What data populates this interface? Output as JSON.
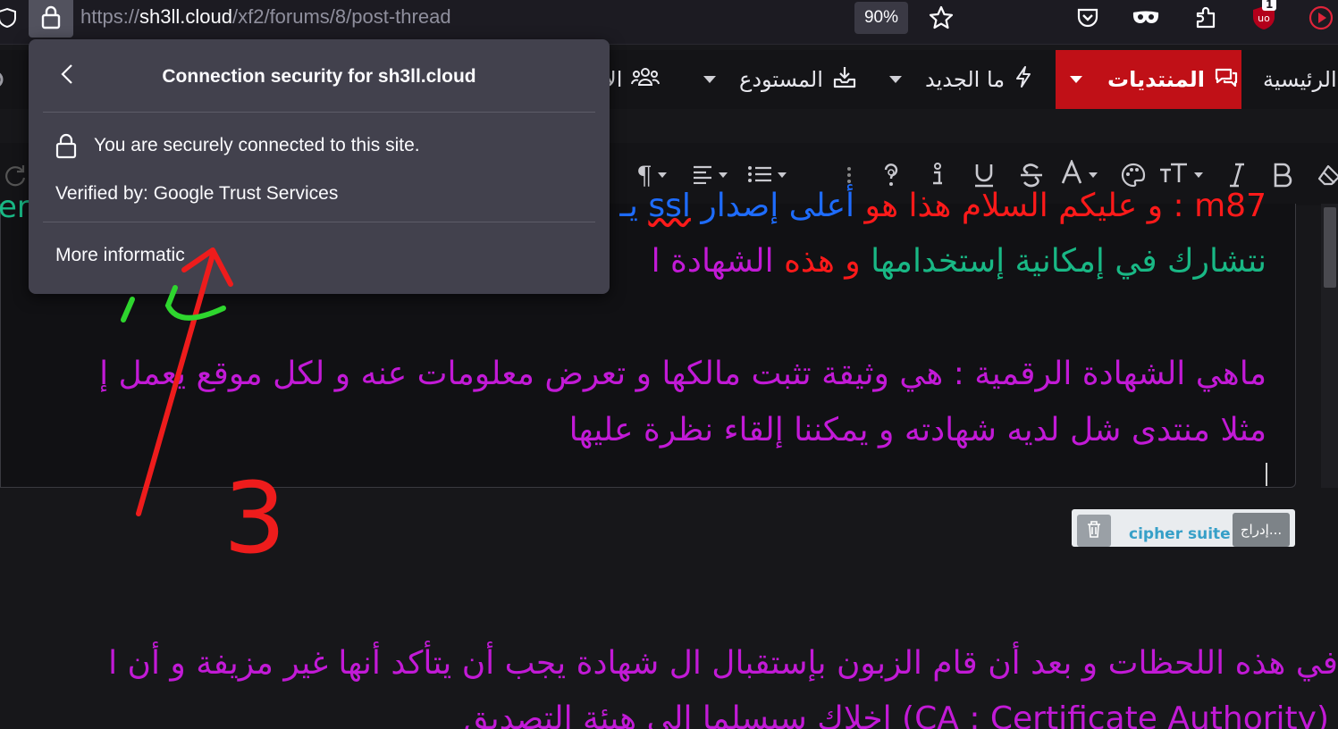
{
  "browser": {
    "url_scheme": "https://",
    "url_host": "sh3ll.cloud",
    "url_path": "/xf2/forums/8/post-thread",
    "zoom": "90%",
    "extension_badge": "1",
    "icons": [
      "shield-icon",
      "lock-icon",
      "star-icon",
      "pocket-icon",
      "mask-icon",
      "extensions-icon",
      "ublock-icon",
      "play-icon"
    ]
  },
  "security_popup": {
    "title": "Connection security for sh3ll.cloud",
    "secure_text": "You are securely connected to this site.",
    "verified_text": "Verified by: Google Trust Services",
    "more_info": "More informatic"
  },
  "site_nav": {
    "items": [
      {
        "label": "الرئيسية"
      },
      {
        "label": "المنتديات",
        "active": true
      },
      {
        "label": "ما الجديد"
      },
      {
        "label": "المستودع"
      },
      {
        "label": "الأ"
      }
    ]
  },
  "editor": {
    "line1": {
      "a": "m87 : و عليكم السلام هذا هو",
      "b": "أعلى إصدار",
      "c": "ssl",
      "d": "يـ"
    },
    "line2": {
      "a": "نتشارك في إمكانية إستخدامها",
      "b": "و هذه",
      "c": "الشهادة ا"
    },
    "line3": "ماهي الشهادة الرقمية : هي وثيقة تثبت مالكها و تعرض معلومات عنه و لكل موقع يعمل  إ",
    "line4": "مثلا منتدى شل لديه شهادته و يمكننا إلقاء نظرة عليها",
    "left_fragment": "er"
  },
  "attachment": {
    "text": "cipher suite",
    "insert_label": "إدراج..."
  },
  "below_text": {
    "line1": "في هذه اللحظات و بعد أن قام الزبون بإستقبال ال شهادة يجب أن يتأكد أنها غير مزيفة و أن ا",
    "line2": "(CA : Certificate Authority)  إخلاك سيسلما الى هيئة التصديق"
  },
  "annotation": {
    "number": "3",
    "color": "#ee1c1c"
  },
  "colors": {
    "accent_red": "#c01017",
    "popup_bg": "#42414d",
    "text_red": "#ff1a1a",
    "text_blue": "#1e6cff",
    "text_green": "#19b885",
    "text_magenta": "#c21ad6"
  }
}
